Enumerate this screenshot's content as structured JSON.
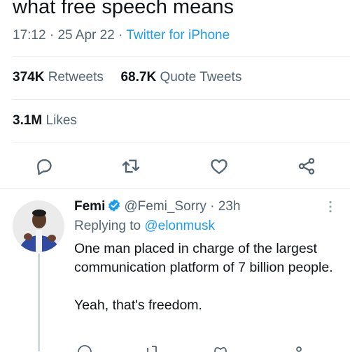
{
  "tweet": {
    "text_tail": "what free speech means",
    "time": "17:12",
    "date": "25 Apr 22",
    "source": "Twitter for iPhone",
    "retweets_count": "374K",
    "retweets_label": "Retweets",
    "quotes_count": "68.7K",
    "quotes_label": "Quote Tweets",
    "likes_count": "3.1M",
    "likes_label": "Likes"
  },
  "actions": {
    "icons": [
      "reply-icon",
      "retweet-icon",
      "like-icon",
      "share-icon"
    ]
  },
  "reply": {
    "name": "Femi",
    "handle": "@Femi_Sorry",
    "age": "23h",
    "replying_label": "Replying to",
    "replying_to": "@elonmusk",
    "text_line1": "One man placed in charge of the largest communication platform of 7 billion people.",
    "text_line2": "Yeah, that's freedom.",
    "verified": true
  },
  "colors": {
    "accent": "#1d9bf0",
    "text": "#0f1419",
    "muted": "#536471",
    "divider": "#e8ebed"
  }
}
